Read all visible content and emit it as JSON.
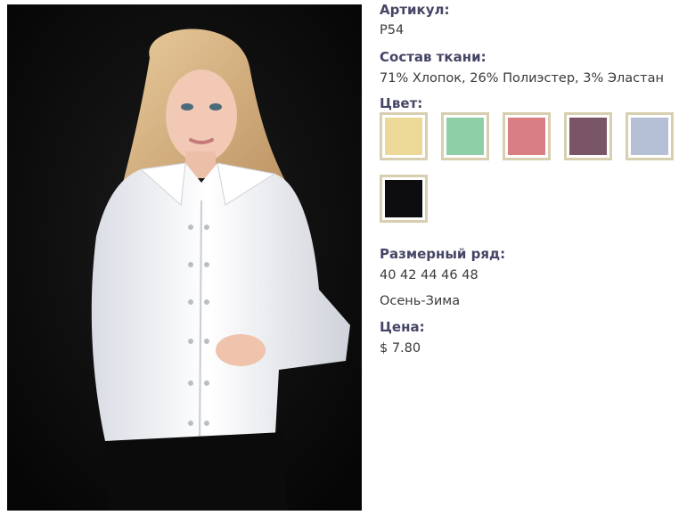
{
  "product": {
    "article_label": "Артикул:",
    "article_value": "P54",
    "fabric_label": "Состав ткани:",
    "fabric_value": "71% Хлопок, 26% Полиэстер, 3% Эластан",
    "color_label": "Цвет:",
    "colors": [
      {
        "name": "yellow",
        "hex": "#ecd998"
      },
      {
        "name": "green",
        "hex": "#8fcfa8"
      },
      {
        "name": "pink",
        "hex": "#d97f84"
      },
      {
        "name": "plum",
        "hex": "#7a5565"
      },
      {
        "name": "light-blue",
        "hex": "#b5bfd6"
      },
      {
        "name": "black",
        "hex": "#0d0d10"
      }
    ],
    "sizes_label": "Размерный ряд:",
    "sizes_value": "40 42 44 46 48",
    "season_value": "Осень-Зима",
    "price_label": "Цена:",
    "price_value": "$ 7.80"
  }
}
